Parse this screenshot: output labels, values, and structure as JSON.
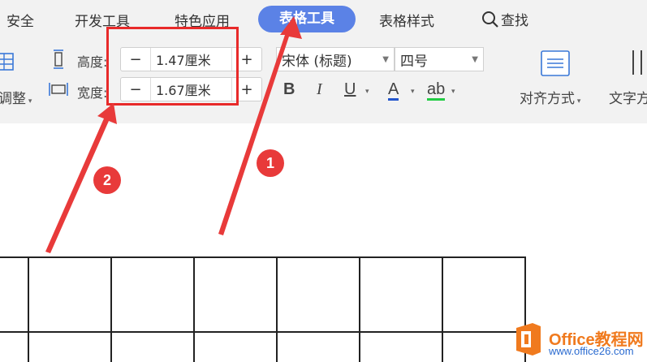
{
  "menu": {
    "items": [
      "安全",
      "开发工具",
      "特色应用",
      "表格工具",
      "表格样式"
    ],
    "active_item": "表格工具",
    "search_label": "查找"
  },
  "ribbon": {
    "adjust_label": "调整",
    "height_label": "高度:",
    "height_value": "1.47厘米",
    "width_label": "宽度:",
    "width_value": "1.67厘米",
    "minus_glyph": "−",
    "plus_glyph": "+",
    "font_family_value": "宋体 (标题)",
    "font_size_value": "四号",
    "bold_label": "B",
    "italic_label": "I",
    "underline_label": "U",
    "font_color_label": "A",
    "highlight_label": "ab",
    "align_label": "对齐方式",
    "text_direction_label": "文字方"
  },
  "annotations": {
    "badge_1": "1",
    "badge_2": "2",
    "highlight_color": "#e82a2a",
    "arrow_color": "#e83a3a"
  },
  "watermark": {
    "brand": "Office教程网",
    "url": "www.office26.com"
  },
  "colors": {
    "active_tab_bg": "#5b82e6",
    "ribbon_bg": "#f2f2f2",
    "font_color_underline": "#2255cc",
    "highlight_underline": "#22cc44"
  }
}
